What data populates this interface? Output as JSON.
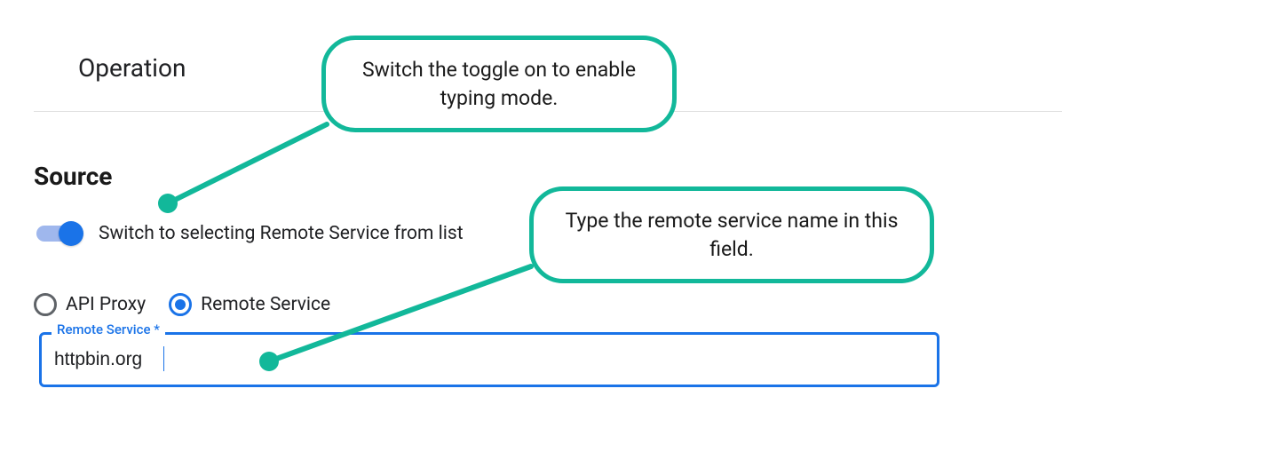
{
  "operation": {
    "title": "Operation"
  },
  "source": {
    "title": "Source",
    "toggle_label": "Switch to selecting Remote Service from list",
    "toggle_on": true,
    "radios": {
      "api_proxy": "API Proxy",
      "remote_service": "Remote Service",
      "selected": "remote_service"
    },
    "field": {
      "legend": "Remote Service *",
      "value": "httpbin.org"
    }
  },
  "callouts": {
    "toggle": "Switch the toggle on to enable typing mode.",
    "field": "Type the remote service name in this field."
  },
  "colors": {
    "accent_teal": "#12b89a",
    "accent_blue": "#1a73e8"
  }
}
